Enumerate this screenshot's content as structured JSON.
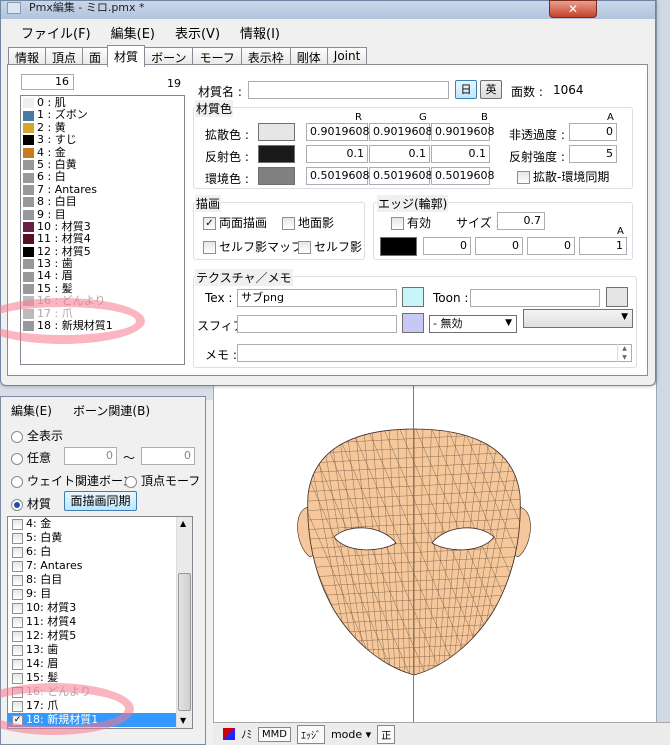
{
  "window": {
    "title": "Pmx編集 - ミロ.pmx *",
    "close": "✕"
  },
  "menu": [
    "ファイル(F)",
    "編集(E)",
    "表示(V)",
    "情報(I)"
  ],
  "tabs": [
    "情報",
    "頂点",
    "面",
    "材質",
    "ボーン",
    "モーフ",
    "表示枠",
    "剛体",
    "Joint"
  ],
  "material_list": {
    "index": "16",
    "count": "19",
    "items": [
      {
        "label": "0 : 肌",
        "color": "#f0f0f0",
        "faded": false
      },
      {
        "label": "1 : ズボン",
        "color": "#4a7a9f",
        "faded": false
      },
      {
        "label": "2 : 黄",
        "color": "#d6a52a",
        "faded": false
      },
      {
        "label": "3 : すじ",
        "color": "#000000",
        "faded": false
      },
      {
        "label": "4 : 金",
        "color": "#c87a1e",
        "faded": false
      },
      {
        "label": "5 : 白黄",
        "color": "#999999",
        "faded": false
      },
      {
        "label": "6 : 白",
        "color": "#999999",
        "faded": false
      },
      {
        "label": "7 : Antares",
        "color": "#999999",
        "faded": false
      },
      {
        "label": "8 : 白目",
        "color": "#999999",
        "faded": false
      },
      {
        "label": "9 : 目",
        "color": "#999999",
        "faded": false
      },
      {
        "label": "10 : 材質3",
        "color": "#6a2040",
        "faded": false
      },
      {
        "label": "11 : 材質4",
        "color": "#5a1020",
        "faded": false
      },
      {
        "label": "12 : 材質5",
        "color": "#000000",
        "faded": false
      },
      {
        "label": "13 : 歯",
        "color": "#999999",
        "faded": false
      },
      {
        "label": "14 : 眉",
        "color": "#999999",
        "faded": false
      },
      {
        "label": "15 : 髪",
        "color": "#999999",
        "faded": false
      },
      {
        "label": "16 : どんより",
        "color": "#bbbbbb",
        "faded": true
      },
      {
        "label": "17 : 爪",
        "color": "#bbbbbb",
        "faded": true
      },
      {
        "label": "18 : 新規材質1",
        "color": "#999999",
        "faded": false
      }
    ]
  },
  "material": {
    "name_label": "材質名 :",
    "name_value": "",
    "jp_button": "日",
    "en_button": "英",
    "faces_label": "面数 :",
    "faces_value": "1064",
    "color_group": "材質色",
    "col_r": "R",
    "col_g": "G",
    "col_b": "B",
    "col_a": "A",
    "diffuse_label": "拡散色 :",
    "diffuse": [
      "0.9019608",
      "0.9019608",
      "0.9019608"
    ],
    "diffuse_color": "#e6e6e6",
    "specular_label": "反射色 :",
    "specular": [
      "0.1",
      "0.1",
      "0.1"
    ],
    "specular_color": "#1a1a1a",
    "ambient_label": "環境色 :",
    "ambient": [
      "0.5019608",
      "0.5019608",
      "0.5019608"
    ],
    "ambient_color": "#808080",
    "opacity_label": "非透過度 :",
    "opacity": "0",
    "spec_power_label": "反射強度 :",
    "spec_power": "5",
    "sync_label": "拡散-環境同期"
  },
  "draw": {
    "group": "描画",
    "double_sided": "両面描画",
    "ground_shadow": "地面影",
    "self_shadow_map": "セルフ影マップ",
    "self_shadow": "セルフ影"
  },
  "edge": {
    "group": "エッジ(輪郭)",
    "enabled": "有効",
    "size_label": "サイズ :",
    "size": "0.7",
    "a_label": "A",
    "rgba": [
      "0",
      "0",
      "0",
      "1"
    ],
    "color": "#000000"
  },
  "texture": {
    "group": "テクスチャ／メモ",
    "tex_label": "Tex :",
    "tex_value": "サブpng",
    "tex_color": "#c8f6f8",
    "toon_label": "Toon :",
    "toon_value": "",
    "toon_color": "#e4e4e4",
    "sphere_label": "スフィア :",
    "sphere_value": "",
    "sphere_color": "#c8c8f4",
    "sphere_mode": "- 無効",
    "toon_select": "",
    "memo_label": "メモ :",
    "memo_value": ""
  },
  "sidebar": {
    "menu": [
      "編集(E)",
      "ボーン関連(B)"
    ],
    "show_all": "全表示",
    "any": "任意",
    "any_from": "0",
    "tilde": "〜",
    "any_to": "0",
    "weight_bone": "ウェイト関連ボーン",
    "vertex_morph": "頂点モーフ",
    "material": "材質",
    "sync_button": "面描画同期",
    "items": [
      {
        "label": "4: 金",
        "checked": false,
        "faded": false,
        "selected": false
      },
      {
        "label": "5: 白黄",
        "checked": false,
        "faded": false,
        "selected": false
      },
      {
        "label": "6: 白",
        "checked": false,
        "faded": false,
        "selected": false
      },
      {
        "label": "7: Antares",
        "checked": false,
        "faded": false,
        "selected": false
      },
      {
        "label": "8: 白目",
        "checked": false,
        "faded": false,
        "selected": false
      },
      {
        "label": "9: 目",
        "checked": false,
        "faded": false,
        "selected": false
      },
      {
        "label": "10: 材質3",
        "checked": false,
        "faded": false,
        "selected": false
      },
      {
        "label": "11: 材質4",
        "checked": false,
        "faded": false,
        "selected": false
      },
      {
        "label": "12: 材質5",
        "checked": false,
        "faded": false,
        "selected": false
      },
      {
        "label": "13: 歯",
        "checked": false,
        "faded": false,
        "selected": false
      },
      {
        "label": "14: 眉",
        "checked": false,
        "faded": false,
        "selected": false
      },
      {
        "label": "15: 髪",
        "checked": false,
        "faded": false,
        "selected": false
      },
      {
        "label": "16: どんより",
        "checked": false,
        "faded": true,
        "selected": false
      },
      {
        "label": "17: 爪",
        "checked": false,
        "faded": false,
        "selected": false
      },
      {
        "label": "18: 新規材質1",
        "checked": true,
        "faded": false,
        "selected": true
      }
    ]
  },
  "viewbar": {
    "nomi": "ﾉﾐ",
    "mmd": "MMD",
    "edge": "ｴｯｼﾞ",
    "mode": "mode",
    "sei": "正"
  },
  "colors": {
    "face_fill": "#f5c79a",
    "face_line": "#3a2a20",
    "highlight_ring": "#f5788c",
    "selection": "#3399ff"
  }
}
